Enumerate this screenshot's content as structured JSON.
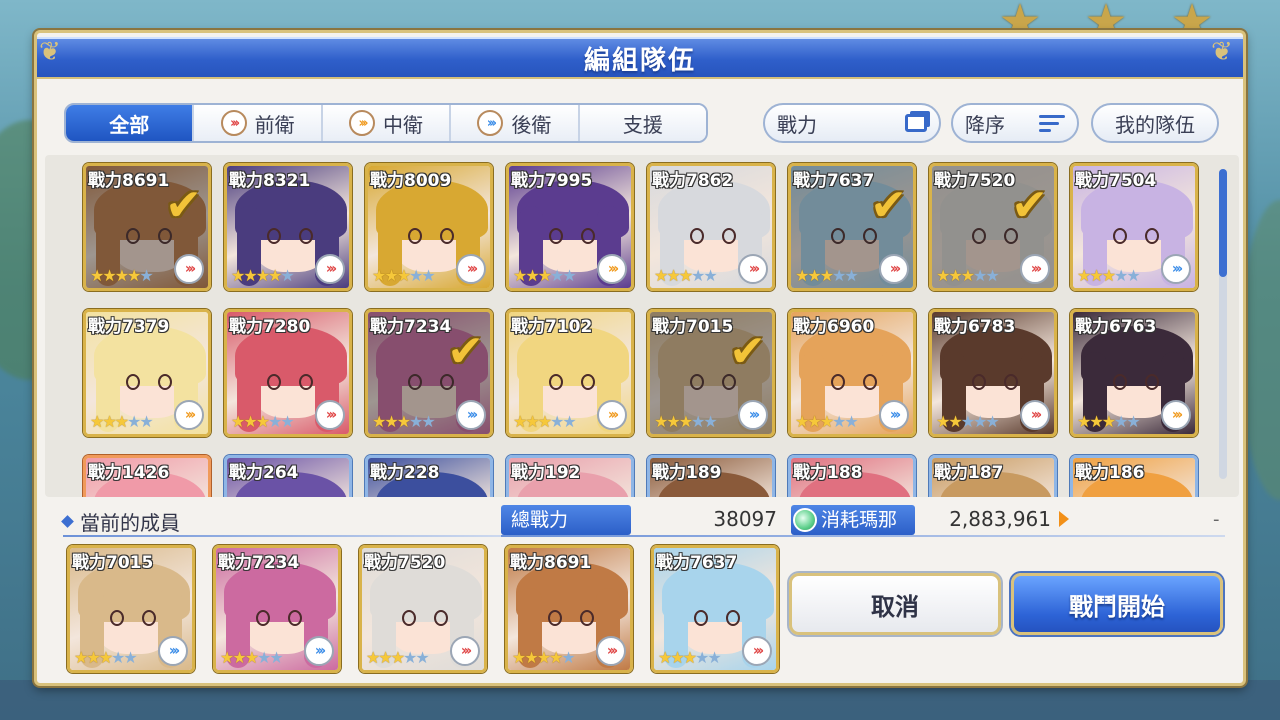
{
  "title": "編組隊伍",
  "filter_tabs": [
    {
      "label": "全部",
      "role": "",
      "active": true
    },
    {
      "label": "前衛",
      "role": "red"
    },
    {
      "label": "中衛",
      "role": "orange"
    },
    {
      "label": "後衛",
      "role": "blue"
    },
    {
      "label": "支援",
      "role": ""
    }
  ],
  "sort": {
    "field_label": "戰力",
    "order_label": "降序",
    "my_team_label": "我的隊伍"
  },
  "characters": [
    {
      "power": "戰力8691",
      "stars": 4,
      "role": "red",
      "selected": true,
      "hair": "#c07a45",
      "frame": "gold"
    },
    {
      "power": "戰力8321",
      "stars": 4,
      "role": "red",
      "selected": false,
      "hair": "#4a3c7e",
      "frame": "gold"
    },
    {
      "power": "戰力8009",
      "stars": 3,
      "role": "red",
      "selected": false,
      "hair": "#d8a832",
      "frame": "gold"
    },
    {
      "power": "戰力7995",
      "stars": 3,
      "role": "orange",
      "selected": false,
      "hair": "#5b3c8f",
      "frame": "gold"
    },
    {
      "power": "戰力7862",
      "stars": 3,
      "role": "red",
      "selected": false,
      "hair": "#d7d9dd",
      "frame": "gold"
    },
    {
      "power": "戰力7637",
      "stars": 3,
      "role": "red",
      "selected": true,
      "hair": "#a8d4ec",
      "frame": "gold"
    },
    {
      "power": "戰力7520",
      "stars": 3,
      "role": "red",
      "selected": true,
      "hair": "#dfdcd8",
      "frame": "gold"
    },
    {
      "power": "戰力7504",
      "stars": 3,
      "role": "blue",
      "selected": false,
      "hair": "#c8b3e3",
      "frame": "gold"
    },
    {
      "power": "戰力7379",
      "stars": 3,
      "role": "orange",
      "selected": false,
      "hair": "#f3e2a0",
      "frame": "gold"
    },
    {
      "power": "戰力7280",
      "stars": 3,
      "role": "red",
      "selected": false,
      "hair": "#d95a6a",
      "frame": "gold"
    },
    {
      "power": "戰力7234",
      "stars": 3,
      "role": "blue",
      "selected": true,
      "hair": "#cc6aa0",
      "frame": "gold"
    },
    {
      "power": "戰力7102",
      "stars": 3,
      "role": "orange",
      "selected": false,
      "hair": "#f1d680",
      "frame": "gold"
    },
    {
      "power": "戰力7015",
      "stars": 3,
      "role": "blue",
      "selected": true,
      "hair": "#d9b98a",
      "frame": "gold"
    },
    {
      "power": "戰力6960",
      "stars": 3,
      "role": "blue",
      "selected": false,
      "hair": "#e5a35a",
      "frame": "gold"
    },
    {
      "power": "戰力6783",
      "stars": 2,
      "role": "red",
      "selected": false,
      "hair": "#5a3a2c",
      "frame": "gold"
    },
    {
      "power": "戰力6763",
      "stars": 3,
      "role": "orange",
      "selected": false,
      "hair": "#3b2a3a",
      "frame": "gold"
    },
    {
      "power": "戰力1426",
      "stars": 0,
      "role": "",
      "selected": false,
      "hair": "#f09aa8",
      "frame": "orange"
    },
    {
      "power": "戰力264",
      "stars": 0,
      "role": "",
      "selected": false,
      "hair": "#6a52a6",
      "frame": "blue"
    },
    {
      "power": "戰力228",
      "stars": 0,
      "role": "",
      "selected": false,
      "hair": "#3c4f9e",
      "frame": "blue"
    },
    {
      "power": "戰力192",
      "stars": 0,
      "role": "",
      "selected": false,
      "hair": "#e9a0ac",
      "frame": "blue"
    },
    {
      "power": "戰力189",
      "stars": 0,
      "role": "",
      "selected": false,
      "hair": "#8a5a3a",
      "frame": "blue"
    },
    {
      "power": "戰力188",
      "stars": 0,
      "role": "",
      "selected": false,
      "hair": "#e07080",
      "frame": "blue"
    },
    {
      "power": "戰力187",
      "stars": 0,
      "role": "",
      "selected": false,
      "hair": "#c89a60",
      "frame": "blue"
    },
    {
      "power": "戰力186",
      "stars": 0,
      "role": "",
      "selected": false,
      "hair": "#f0a040",
      "frame": "blue"
    }
  ],
  "current_members": {
    "label": "當前的成員",
    "list": [
      {
        "power": "戰力7015",
        "stars": 3,
        "role": "blue",
        "hair": "#d9b98a"
      },
      {
        "power": "戰力7234",
        "stars": 3,
        "role": "blue",
        "hair": "#cc6aa0"
      },
      {
        "power": "戰力7520",
        "stars": 3,
        "role": "red",
        "hair": "#dfdcd8"
      },
      {
        "power": "戰力8691",
        "stars": 4,
        "role": "red",
        "hair": "#c07a45"
      },
      {
        "power": "戰力7637",
        "stars": 3,
        "role": "red",
        "hair": "#a8d4ec"
      }
    ]
  },
  "stats": {
    "total_power_label": "總戰力",
    "total_power_value": "38097",
    "mana_label": "消耗瑪那",
    "mana_value": "2,883,961",
    "mana_extra": "-"
  },
  "buttons": {
    "cancel": "取消",
    "start": "戰鬥開始"
  },
  "colors": {
    "accent": "#2f5fca",
    "gold_frame": "#d9b34a",
    "role_red": "#e04848",
    "role_orange": "#f09a1e",
    "role_blue": "#3d8ee8"
  }
}
